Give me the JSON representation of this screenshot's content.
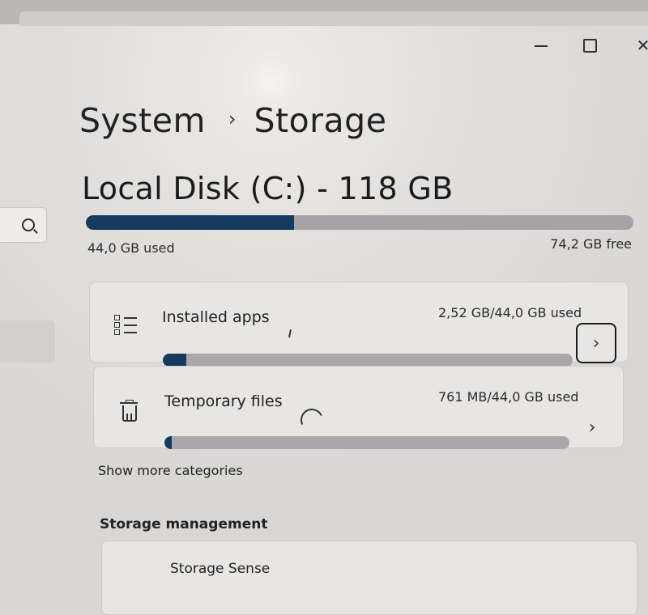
{
  "window": {
    "controls": {
      "minimize": "—",
      "maximize": "□",
      "close": "✕"
    }
  },
  "breadcrumb": {
    "parent": "System",
    "separator": "›",
    "current": "Storage"
  },
  "disk": {
    "title": "Local Disk (C:) - 118 GB",
    "used_label": "44,0 GB used",
    "free_label": "74,2 GB free",
    "used_fraction": 0.38
  },
  "categories": [
    {
      "label": "Installed apps",
      "amount": "2,52 GB/44,0 GB used",
      "fraction": 0.057,
      "icon": "list-icon"
    },
    {
      "label": "Temporary files",
      "amount": "761 MB/44,0 GB used",
      "fraction": 0.017,
      "icon": "trash-icon"
    }
  ],
  "show_more": "Show more categories",
  "storage_management": {
    "heading": "Storage management",
    "items": [
      {
        "label": "Storage Sense"
      }
    ]
  },
  "colors": {
    "bar_fill": "#143a5e",
    "bar_track": "#a5a3a6"
  },
  "chevron": "›"
}
